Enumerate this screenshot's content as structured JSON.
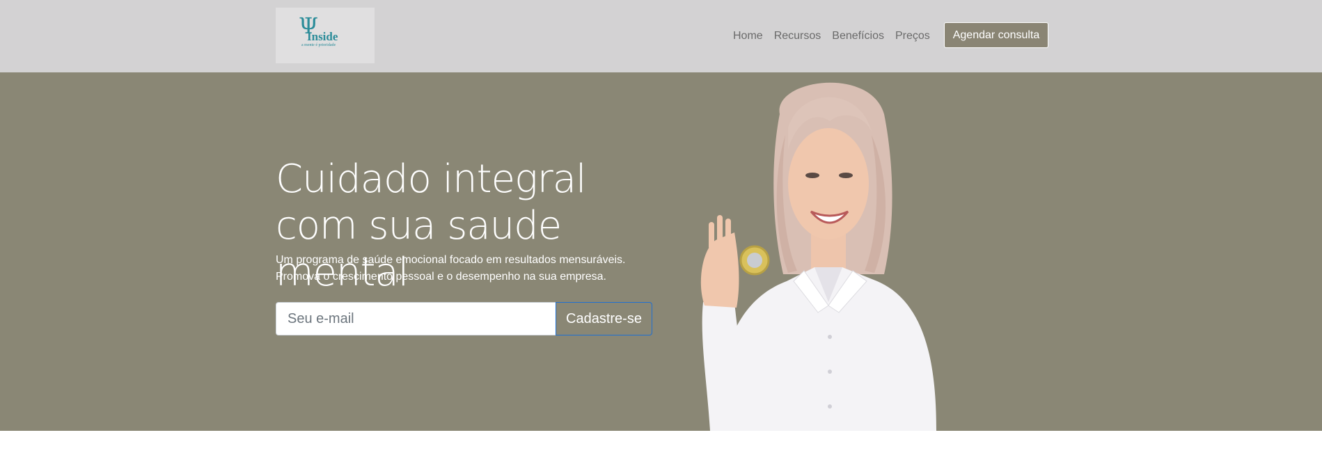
{
  "navbar": {
    "logo": {
      "mark": "Ψ",
      "brand": "Inside",
      "tagline": "a mente é prioridade"
    },
    "links": [
      {
        "label": "Home"
      },
      {
        "label": "Recursos"
      },
      {
        "label": "Benefícios"
      },
      {
        "label": "Preços"
      }
    ],
    "cta_label": "Agendar consulta"
  },
  "hero": {
    "title": "Cuidado integral com sua saude mental",
    "subtitle_line1": "Um programa de saúde emocional focado em resultados mensuráveis.",
    "subtitle_line2": "Promova o crescimento pessoal e o desempenho na sua empresa.",
    "email_placeholder": "Seu e-mail",
    "signup_label": "Cadastre-se"
  },
  "colors": {
    "navbar_bg": "#d3d2d3",
    "hero_bg": "#8a8775",
    "brand_teal": "#2b8c99",
    "button_border_blue": "#1f6fd1"
  }
}
